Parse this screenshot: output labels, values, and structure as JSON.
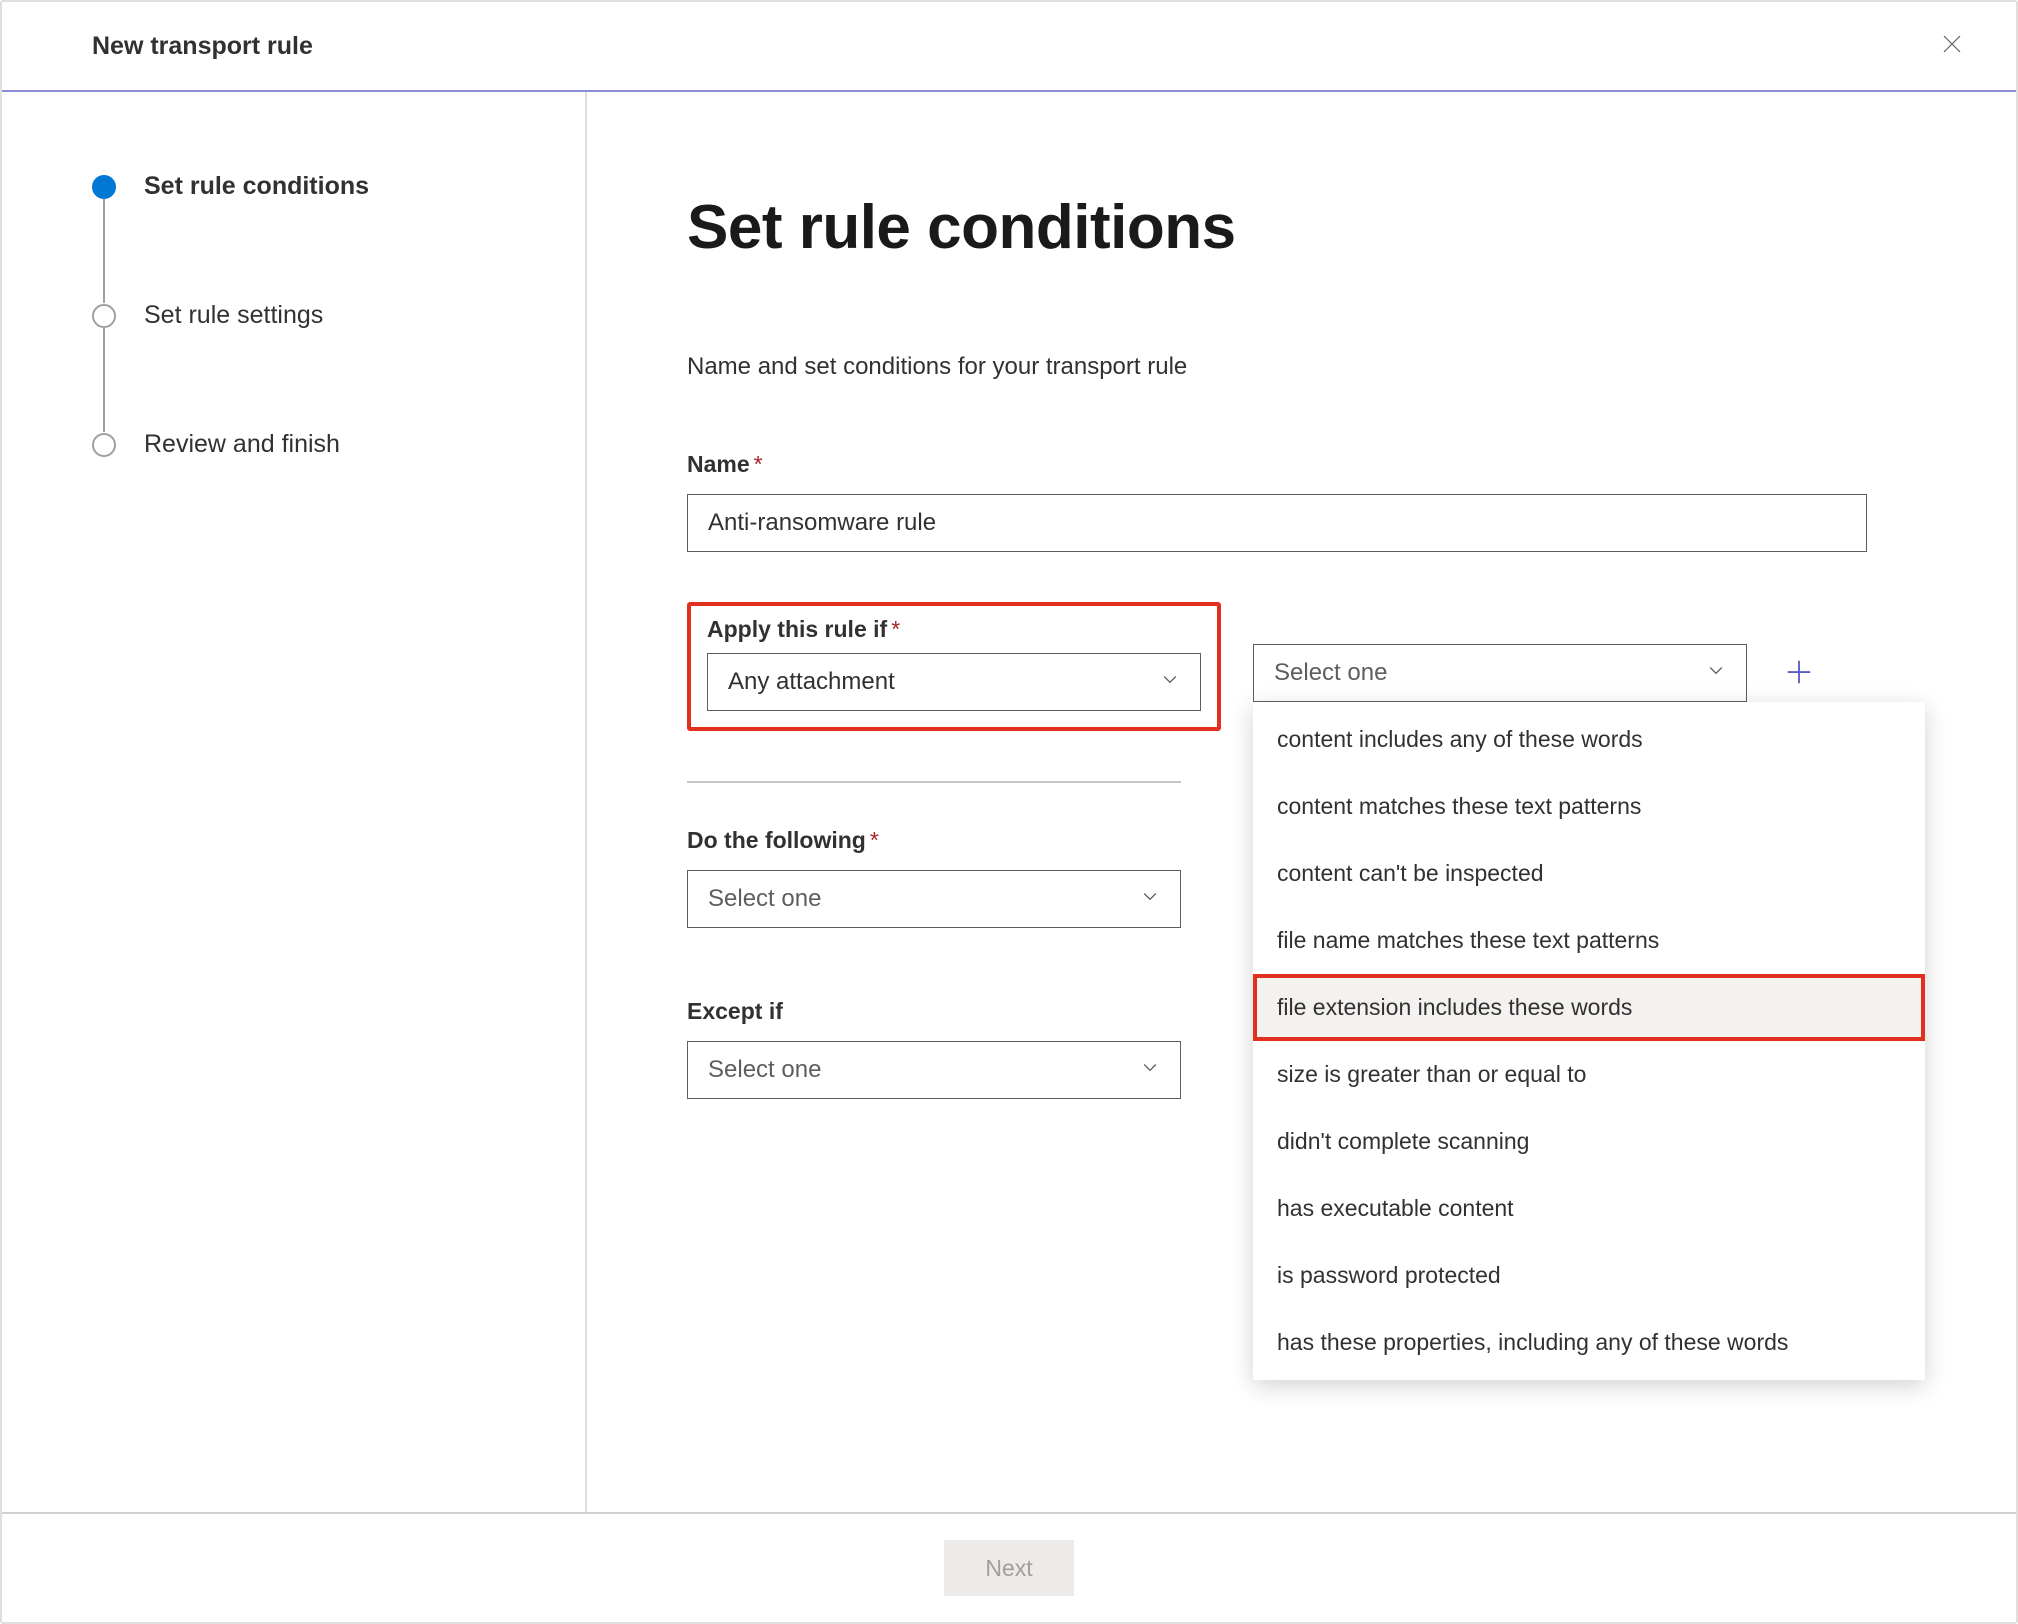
{
  "dialog": {
    "title": "New transport rule"
  },
  "steps": [
    {
      "label": "Set rule conditions",
      "active": true
    },
    {
      "label": "Set rule settings",
      "active": false
    },
    {
      "label": "Review and finish",
      "active": false
    }
  ],
  "page": {
    "heading": "Set rule conditions",
    "subtitle": "Name and set conditions for your transport rule"
  },
  "fields": {
    "name_label": "Name",
    "name_value": "Anti-ransomware rule",
    "apply_if_label": "Apply this rule if",
    "apply_if_value": "Any attachment",
    "apply_if_secondary_placeholder": "Select one",
    "do_following_label": "Do the following",
    "do_following_value": "Select one",
    "except_if_label": "Except if",
    "except_if_value": "Select one"
  },
  "dropdown_options": [
    "content includes any of these words",
    "content matches these text patterns",
    "content can't be inspected",
    "file name matches these text patterns",
    "file extension includes these words",
    "size is greater than or equal to",
    "didn't complete scanning",
    "has executable content",
    "is password protected",
    "has these properties, including any of these words"
  ],
  "dropdown_highlighted_index": 4,
  "footer": {
    "next_label": "Next"
  }
}
